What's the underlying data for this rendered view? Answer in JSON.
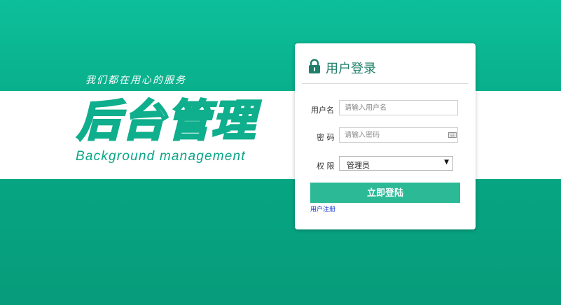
{
  "colors": {
    "background": "#07a884",
    "accent": "#2bb996",
    "title_color": "#1f7f6a",
    "link_color": "#1a3fd6"
  },
  "branding": {
    "slogan": "我们都在用心的服务",
    "title": "后台管理",
    "subtitle": "Background management"
  },
  "login": {
    "title": "用户登录",
    "icon": "lock-icon",
    "username_label": "用户名",
    "username_placeholder": "请输入用户名",
    "password_label": "密 码",
    "password_placeholder": "请输入密码",
    "password_icon": "keyboard-icon",
    "role_label": "权 限",
    "role_selected": "管理员",
    "submit_label": "立即登陆",
    "register_link": "用户注册"
  }
}
